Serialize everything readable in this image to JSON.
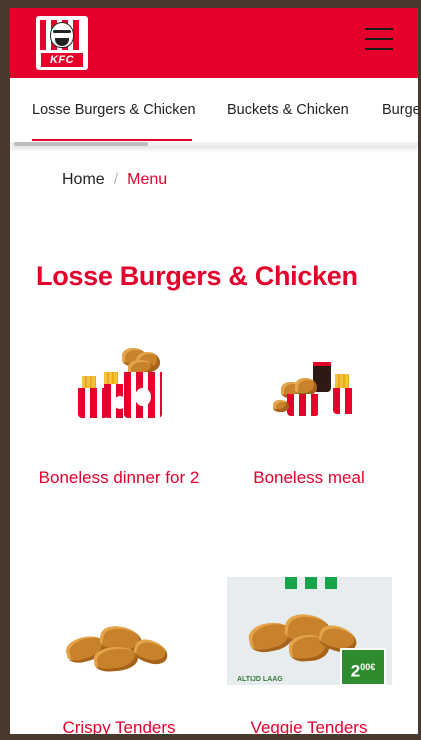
{
  "header": {
    "logo_text": "KFC",
    "menu_icon": "hamburger-menu-icon"
  },
  "tabs": [
    {
      "label": "Losse Burgers & Chicken",
      "active": true
    },
    {
      "label": "Buckets & Chicken",
      "active": false
    },
    {
      "label": "Burge",
      "active": false
    }
  ],
  "breadcrumb": {
    "home": "Home",
    "separator": "/",
    "current": "Menu"
  },
  "page": {
    "title": "Losse Burgers & Chicken"
  },
  "products": [
    {
      "name": "Boneless dinner for 2"
    },
    {
      "name": "Boneless meal"
    },
    {
      "name": "Crispy Tenders"
    },
    {
      "name": "Veggie Tenders"
    }
  ],
  "veggie_banner": {
    "price": "2",
    "price_decimals": "00€",
    "tag": "ALTIJD LAAG"
  },
  "colors": {
    "brand_red": "#e4002b",
    "text_dark": "#222222",
    "badge_green": "#2e8b2e"
  }
}
